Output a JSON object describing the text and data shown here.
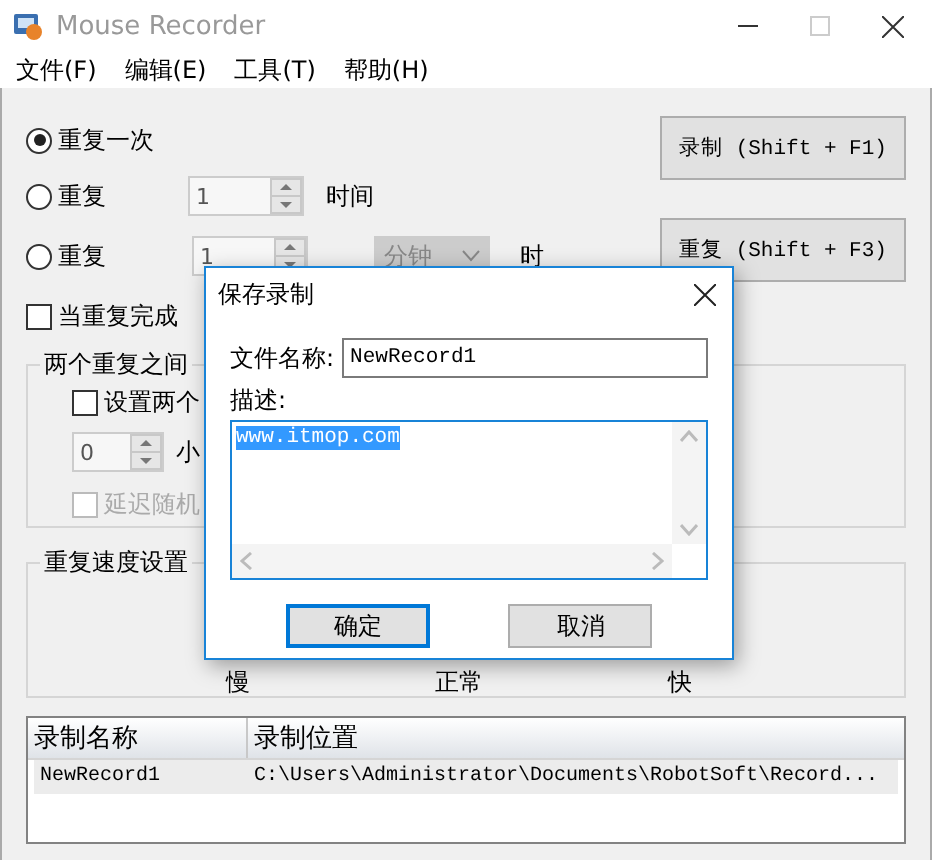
{
  "window": {
    "title": "Mouse Recorder"
  },
  "menu": [
    "文件(F)",
    "编辑(E)",
    "工具(T)",
    "帮助(H)"
  ],
  "repeat_options": [
    {
      "kind": "once",
      "label": "重复一次",
      "selected": true
    },
    {
      "kind": "count",
      "label": "重复",
      "value": "1",
      "unit": "时间",
      "selected": false
    },
    {
      "kind": "duration",
      "label": "重复",
      "value": "1",
      "unit_choice": "分钟",
      "unit_choice_disabled": true,
      "unit": "时",
      "selected": false
    }
  ],
  "buttons": [
    {
      "label": "录制 (Shift + F1)"
    },
    {
      "label": "重复 (Shift + F3)"
    }
  ],
  "on_complete": {
    "label": "当重复完成",
    "checked": false
  },
  "interval_group": {
    "title": "两个重复之间",
    "set_interval": {
      "label": "设置两个",
      "checked": false
    },
    "hours": {
      "value": "0",
      "unit": "小"
    },
    "random_delay": {
      "label": "延迟随机",
      "checked": false,
      "disabled": true
    }
  },
  "speed_group": {
    "title": "重复速度设置",
    "labels": [
      "慢",
      "正常",
      "快"
    ]
  },
  "recordings": {
    "columns": [
      "录制名称",
      "录制位置"
    ],
    "rows": [
      {
        "cells": [
          "NewRecord1",
          "C:\\Users\\Administrator\\Documents\\RobotSoft\\Record..."
        ],
        "selected": true
      }
    ]
  },
  "dialog": {
    "title": "保存录制",
    "name_label": "文件名称:",
    "name_value": "NewRecord1",
    "description_label": "描述:",
    "description_value": "www.itmop.com",
    "buttons": [
      {
        "label": "确定",
        "default": true
      },
      {
        "label": "取消",
        "default": false
      }
    ]
  }
}
